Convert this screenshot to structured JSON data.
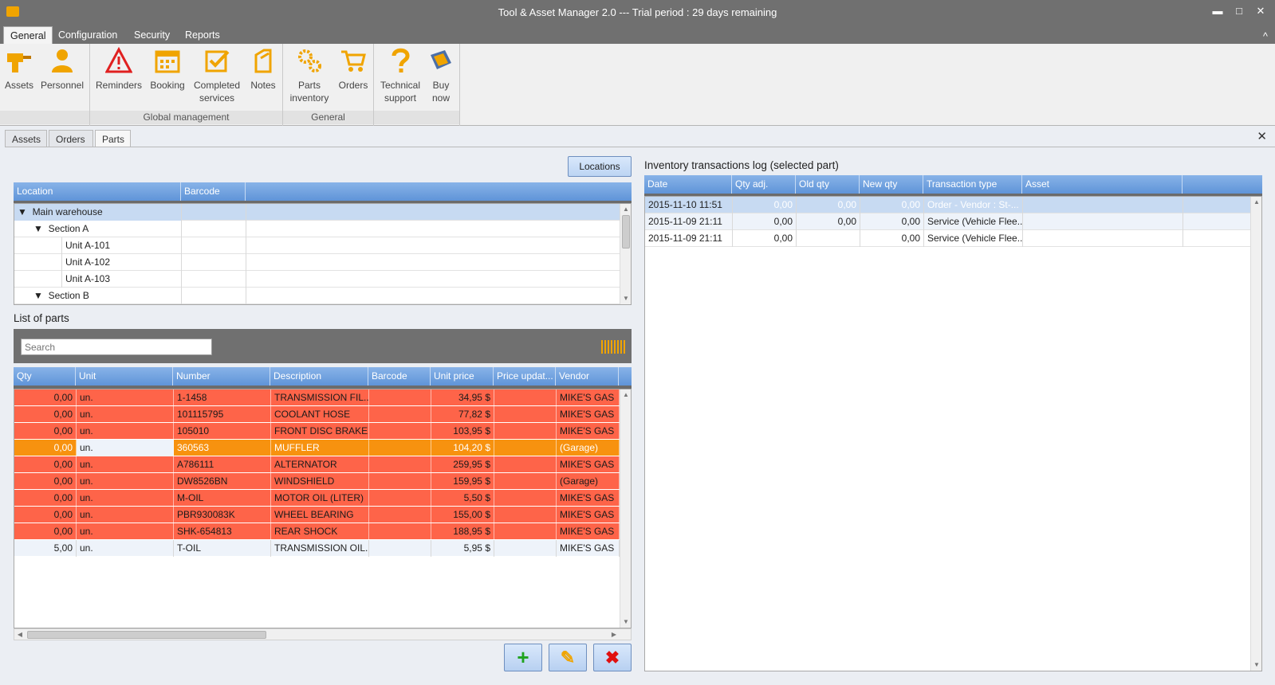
{
  "window": {
    "title": "Tool & Asset Manager 2.0 --- Trial period : 29 days remaining",
    "minimize": "▬",
    "maximize": "□",
    "close": "✕"
  },
  "menu": {
    "tabs": [
      "General",
      "Configuration",
      "Security",
      "Reports"
    ],
    "collapse": "^"
  },
  "ribbon": {
    "buttons": [
      {
        "label": "Assets",
        "icon": "drill-icon"
      },
      {
        "label": "Personnel",
        "icon": "person-icon"
      },
      {
        "label": "Reminders",
        "icon": "warning-icon"
      },
      {
        "label": "Booking",
        "icon": "calendar-icon"
      },
      {
        "label": "Completed services",
        "icon": "checkmark-icon"
      },
      {
        "label": "Notes",
        "icon": "note-icon"
      },
      {
        "label": "Parts inventory",
        "icon": "gears-icon"
      },
      {
        "label": "Orders",
        "icon": "cart-icon"
      },
      {
        "label": "Technical support",
        "icon": "question-icon"
      },
      {
        "label": "Buy now",
        "icon": "buy-icon"
      }
    ],
    "groups": [
      "",
      "Global management",
      "General",
      ""
    ]
  },
  "doc_tabs": [
    "Assets",
    "Orders",
    "Parts"
  ],
  "close_panel": "✕",
  "locations_button": "Locations",
  "locations": {
    "columns": [
      "Location",
      "Barcode"
    ],
    "rows": [
      {
        "toggle": "▼",
        "name": "Main warehouse",
        "barcode": ""
      },
      {
        "toggle": "▼",
        "name": "Section A",
        "barcode": ""
      },
      {
        "toggle": "",
        "name": "Unit A-101",
        "barcode": ""
      },
      {
        "toggle": "",
        "name": "Unit A-102",
        "barcode": ""
      },
      {
        "toggle": "",
        "name": "Unit A-103",
        "barcode": ""
      },
      {
        "toggle": "▼",
        "name": "Section B",
        "barcode": ""
      }
    ]
  },
  "parts": {
    "title": "List of parts",
    "search_placeholder": "Search",
    "columns": [
      "Qty",
      "Unit",
      "Number",
      "Description",
      "Barcode",
      "Unit price",
      "Price updat...",
      "Vendor"
    ],
    "rows": [
      {
        "qty": "0,00",
        "unit": "un.",
        "number": "1-1458",
        "description": "TRANSMISSION FIL...",
        "barcode": "",
        "price": "34,95 $",
        "updated": "",
        "vendor": "MIKE'S GAS",
        "status": "red"
      },
      {
        "qty": "0,00",
        "unit": "un.",
        "number": "101115795",
        "description": "COOLANT HOSE",
        "barcode": "",
        "price": "77,82 $",
        "updated": "",
        "vendor": "MIKE'S GAS",
        "status": "red"
      },
      {
        "qty": "0,00",
        "unit": "un.",
        "number": "105010",
        "description": "FRONT DISC BRAKE",
        "barcode": "",
        "price": "103,95 $",
        "updated": "",
        "vendor": "MIKE'S GAS",
        "status": "red"
      },
      {
        "qty": "0,00",
        "unit": "un.",
        "number": "360563",
        "description": "MUFFLER",
        "barcode": "",
        "price": "104,20 $",
        "updated": "",
        "vendor": "(Garage)",
        "status": "orange"
      },
      {
        "qty": "0,00",
        "unit": "un.",
        "number": "A786111",
        "description": "ALTERNATOR",
        "barcode": "",
        "price": "259,95 $",
        "updated": "",
        "vendor": "MIKE'S GAS",
        "status": "red"
      },
      {
        "qty": "0,00",
        "unit": "un.",
        "number": "DW8526BN",
        "description": "WINDSHIELD",
        "barcode": "",
        "price": "159,95 $",
        "updated": "",
        "vendor": "(Garage)",
        "status": "red"
      },
      {
        "qty": "0,00",
        "unit": "un.",
        "number": "M-OIL",
        "description": "MOTOR OIL (LITER)",
        "barcode": "",
        "price": "5,50 $",
        "updated": "",
        "vendor": "MIKE'S GAS",
        "status": "red"
      },
      {
        "qty": "0,00",
        "unit": "un.",
        "number": "PBR930083K",
        "description": "WHEEL BEARING",
        "barcode": "",
        "price": "155,00 $",
        "updated": "",
        "vendor": "MIKE'S GAS",
        "status": "red"
      },
      {
        "qty": "0,00",
        "unit": "un.",
        "number": "SHK-654813",
        "description": "REAR SHOCK",
        "barcode": "",
        "price": "188,95 $",
        "updated": "",
        "vendor": "MIKE'S GAS",
        "status": "red"
      },
      {
        "qty": "5,00",
        "unit": "un.",
        "number": "T-OIL",
        "description": "TRANSMISSION OIL...",
        "barcode": "",
        "price": "5,95 $",
        "updated": "",
        "vendor": "MIKE'S GAS",
        "status": "white"
      }
    ],
    "actions": {
      "add": "+",
      "edit": "✎",
      "delete": "✖"
    }
  },
  "log": {
    "title": "Inventory transactions log (selected part)",
    "columns": [
      "Date",
      "Qty adj.",
      "Old qty",
      "New qty",
      "Transaction type",
      "Asset"
    ],
    "rows": [
      {
        "date": "2015-11-10 11:51",
        "adj": "0,00",
        "old": "0,00",
        "new": "0,00",
        "type": "Order - Vendor : St-...",
        "asset": ""
      },
      {
        "date": "2015-11-09 21:11",
        "adj": "0,00",
        "old": "0,00",
        "new": "0,00",
        "type": "Service (Vehicle Flee...",
        "asset": ""
      },
      {
        "date": "2015-11-09 21:11",
        "adj": "0,00",
        "old": "",
        "new": "0,00",
        "type": "Service (Vehicle Flee...",
        "asset": ""
      }
    ]
  },
  "colors": {
    "accent": "#5f94d8",
    "low_stock": "#fe6449",
    "warning": "#f7920f",
    "icon_orange": "#f0a400"
  }
}
